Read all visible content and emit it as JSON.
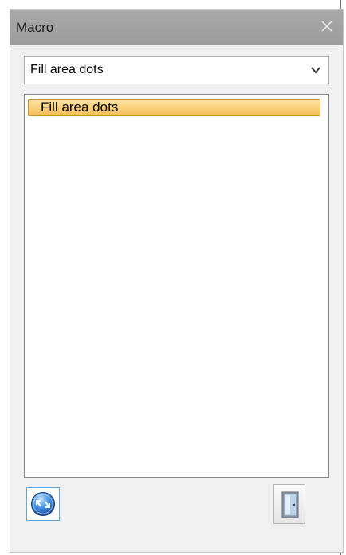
{
  "panel": {
    "title": "Macro",
    "close_icon": "close-icon"
  },
  "macro_select": {
    "selected": "Fill area dots",
    "icon": "chevron-down-icon"
  },
  "macro_list": {
    "items": [
      {
        "label": "Fill area dots",
        "selected": true
      }
    ]
  },
  "toolbar": {
    "run_icon": "run-macro-icon",
    "exit_icon": "door-exit-icon"
  },
  "colors": {
    "titlebar": "#a3a3a3",
    "selection_fill": "#fcd27e",
    "selection_border": "#c9922c",
    "run_accent": "#2f6fc0"
  }
}
